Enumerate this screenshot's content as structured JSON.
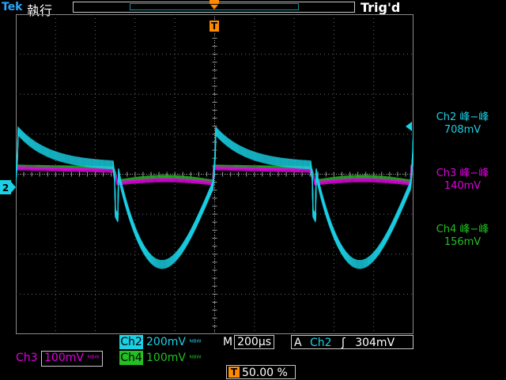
{
  "header": {
    "brand": "Tek",
    "run_state": "執行",
    "trigger_status": "Trig'd"
  },
  "measurements": [
    {
      "name": "Ch2 峰−峰",
      "value": "708mV",
      "color": "#1ad1e6"
    },
    {
      "name": "Ch3 峰−峰",
      "value": "140mV",
      "color": "#e000e0"
    },
    {
      "name": "Ch4 峰−峰",
      "value": "156mV",
      "color": "#22c022"
    }
  ],
  "channels": {
    "ch2": {
      "label": "Ch2",
      "scale": "200mV",
      "color": "#1ad1e6"
    },
    "ch3": {
      "label": "Ch3",
      "scale": "100mV",
      "color": "#e000e0"
    },
    "ch4": {
      "label": "Ch4",
      "scale": "100mV",
      "color": "#22c022"
    },
    "bw_symbol": "ᴺᴮᵂ"
  },
  "timebase": {
    "label": "M",
    "value": "200μs"
  },
  "trigger": {
    "mode": "A",
    "source": "Ch2",
    "slope": "ʃ",
    "level": "304mV"
  },
  "position": {
    "marker": "T",
    "value": "50.00 %"
  },
  "markers": {
    "ch2_ground": "2",
    "trigger_top": "T"
  }
}
